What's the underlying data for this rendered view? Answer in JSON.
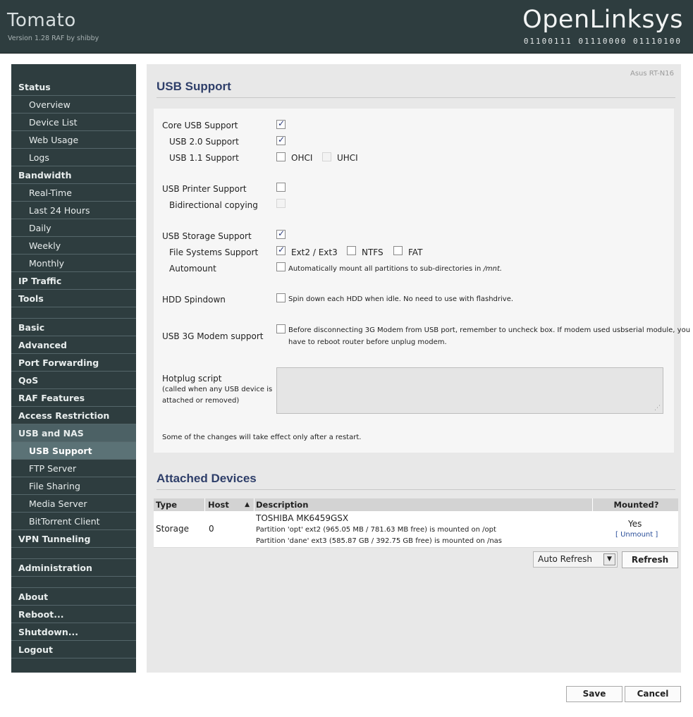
{
  "header": {
    "title": "Tomato",
    "version": "Version 1.28 RAF by shibby",
    "logo": "OpenLinksys",
    "logo_binary": "01100111 01110000 01110100"
  },
  "sidebar": {
    "status": "Status",
    "overview": "Overview",
    "device_list": "Device List",
    "web_usage": "Web Usage",
    "logs": "Logs",
    "bandwidth": "Bandwidth",
    "real_time": "Real-Time",
    "last_24": "Last 24 Hours",
    "daily": "Daily",
    "weekly": "Weekly",
    "monthly": "Monthly",
    "ip_traffic": "IP Traffic",
    "tools": "Tools",
    "basic": "Basic",
    "advanced": "Advanced",
    "port_forwarding": "Port Forwarding",
    "qos": "QoS",
    "raf_features": "RAF Features",
    "access_restriction": "Access Restriction",
    "usb_nas": "USB and NAS",
    "usb_support": "USB Support",
    "ftp_server": "FTP Server",
    "file_sharing": "File Sharing",
    "media_server": "Media Server",
    "bittorrent": "BitTorrent Client",
    "vpn": "VPN Tunneling",
    "administration": "Administration",
    "about": "About",
    "reboot": "Reboot...",
    "shutdown": "Shutdown...",
    "logout": "Logout"
  },
  "content": {
    "model": "Asus RT-N16",
    "title": "USB Support",
    "core_usb": "Core USB Support",
    "usb20": "USB 2.0 Support",
    "usb11": "USB 1.1 Support",
    "ohci": "OHCI",
    "uhci": "UHCI",
    "printer": "USB Printer Support",
    "bidir": "Bidirectional copying",
    "storage": "USB Storage Support",
    "fs_support": "File Systems Support",
    "ext": "Ext2 / Ext3",
    "ntfs": "NTFS",
    "fat": "FAT",
    "automount": "Automount",
    "automount_desc": "Automatically mount all partitions to sub-directories in",
    "automount_path": "/mnt.",
    "spindown": "HDD Spindown",
    "spindown_desc": "Spin down each HDD when idle. No need to use with flashdrive.",
    "modem": "USB 3G Modem support",
    "modem_desc_1": "Before disconnecting 3G Modem from USB port, remember to uncheck box. If modem used usbserial module, you",
    "modem_desc_2": "have to reboot router before unplug modem.",
    "hotplug": "Hotplug script",
    "hotplug_note_1": "(called when any USB device is",
    "hotplug_note_2": "attached or removed)",
    "restart_note": "Some of the changes will take effect only after a restart."
  },
  "devices": {
    "title": "Attached Devices",
    "col_type": "Type",
    "col_host": "Host",
    "sort_glyph": "▲",
    "col_desc": "Description",
    "col_mounted": "Mounted?",
    "row_type": "Storage",
    "row_host": "0",
    "row_name": "TOSHIBA MK6459GSX",
    "row_part1": "Partition 'opt' ext2 (965.05 MB / 781.63 MB free) is mounted on /opt",
    "row_part2": "Partition 'dane' ext3 (585.87 GB / 392.75 GB free) is mounted on /nas",
    "row_mounted": "Yes",
    "unmount": "[ Unmount ]",
    "auto_refresh": "Auto Refresh",
    "refresh": "Refresh"
  },
  "footer": {
    "save": "Save",
    "cancel": "Cancel"
  },
  "colors": {
    "sidebar_bg": "#2e3d3f",
    "title_blue": "#2f3f6a",
    "active_item": "#5b7276"
  }
}
